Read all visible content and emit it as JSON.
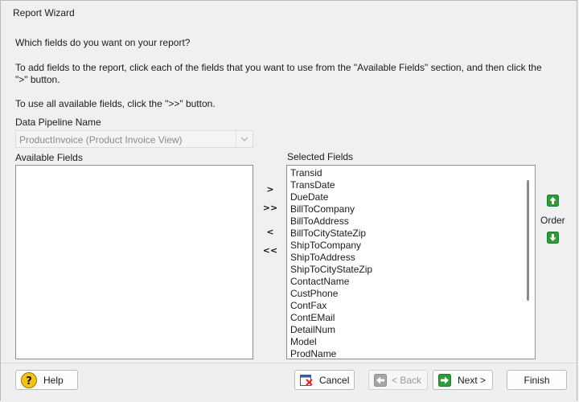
{
  "window": {
    "title": "Report Wizard"
  },
  "intro": {
    "heading": "Which fields do you want on your report?",
    "instruction_add": "To add fields to the report, click each of the fields that you want to use from the \"Available Fields\" section, and then click the \">\" button.",
    "instruction_all": "To use all available fields, click the \">>\" button."
  },
  "pipeline": {
    "label": "Data Pipeline Name",
    "value": "ProductInvoice  (Product Invoice View)"
  },
  "available": {
    "label": "Available Fields",
    "items": []
  },
  "selected": {
    "label": "Selected Fields",
    "items": [
      "Transid",
      "TransDate",
      "DueDate",
      "BillToCompany",
      "BillToAddress",
      "BillToCityStateZip",
      "ShipToCompany",
      "ShipToAddress",
      "ShipToCityStateZip",
      "ContactName",
      "CustPhone",
      "ContFax",
      "ContEMail",
      "DetailNum",
      "Model",
      "ProdName"
    ]
  },
  "move_buttons": {
    "add": ">",
    "add_all": ">>",
    "remove": "<",
    "remove_all": "<<"
  },
  "order": {
    "label": "Order"
  },
  "footer": {
    "help": "Help",
    "cancel": "Cancel",
    "back": "< Back",
    "next": "Next >",
    "finish": "Finish"
  },
  "icons": {
    "order_up": "arrow-up-icon",
    "order_down": "arrow-down-icon",
    "help": "question-icon",
    "cancel": "cancel-icon",
    "back": "back-arrow-icon",
    "next": "next-arrow-icon"
  },
  "colors": {
    "accent_green": "#2f9a3a",
    "cancel_red": "#d8322a",
    "help_yellow": "#f3c21a"
  }
}
